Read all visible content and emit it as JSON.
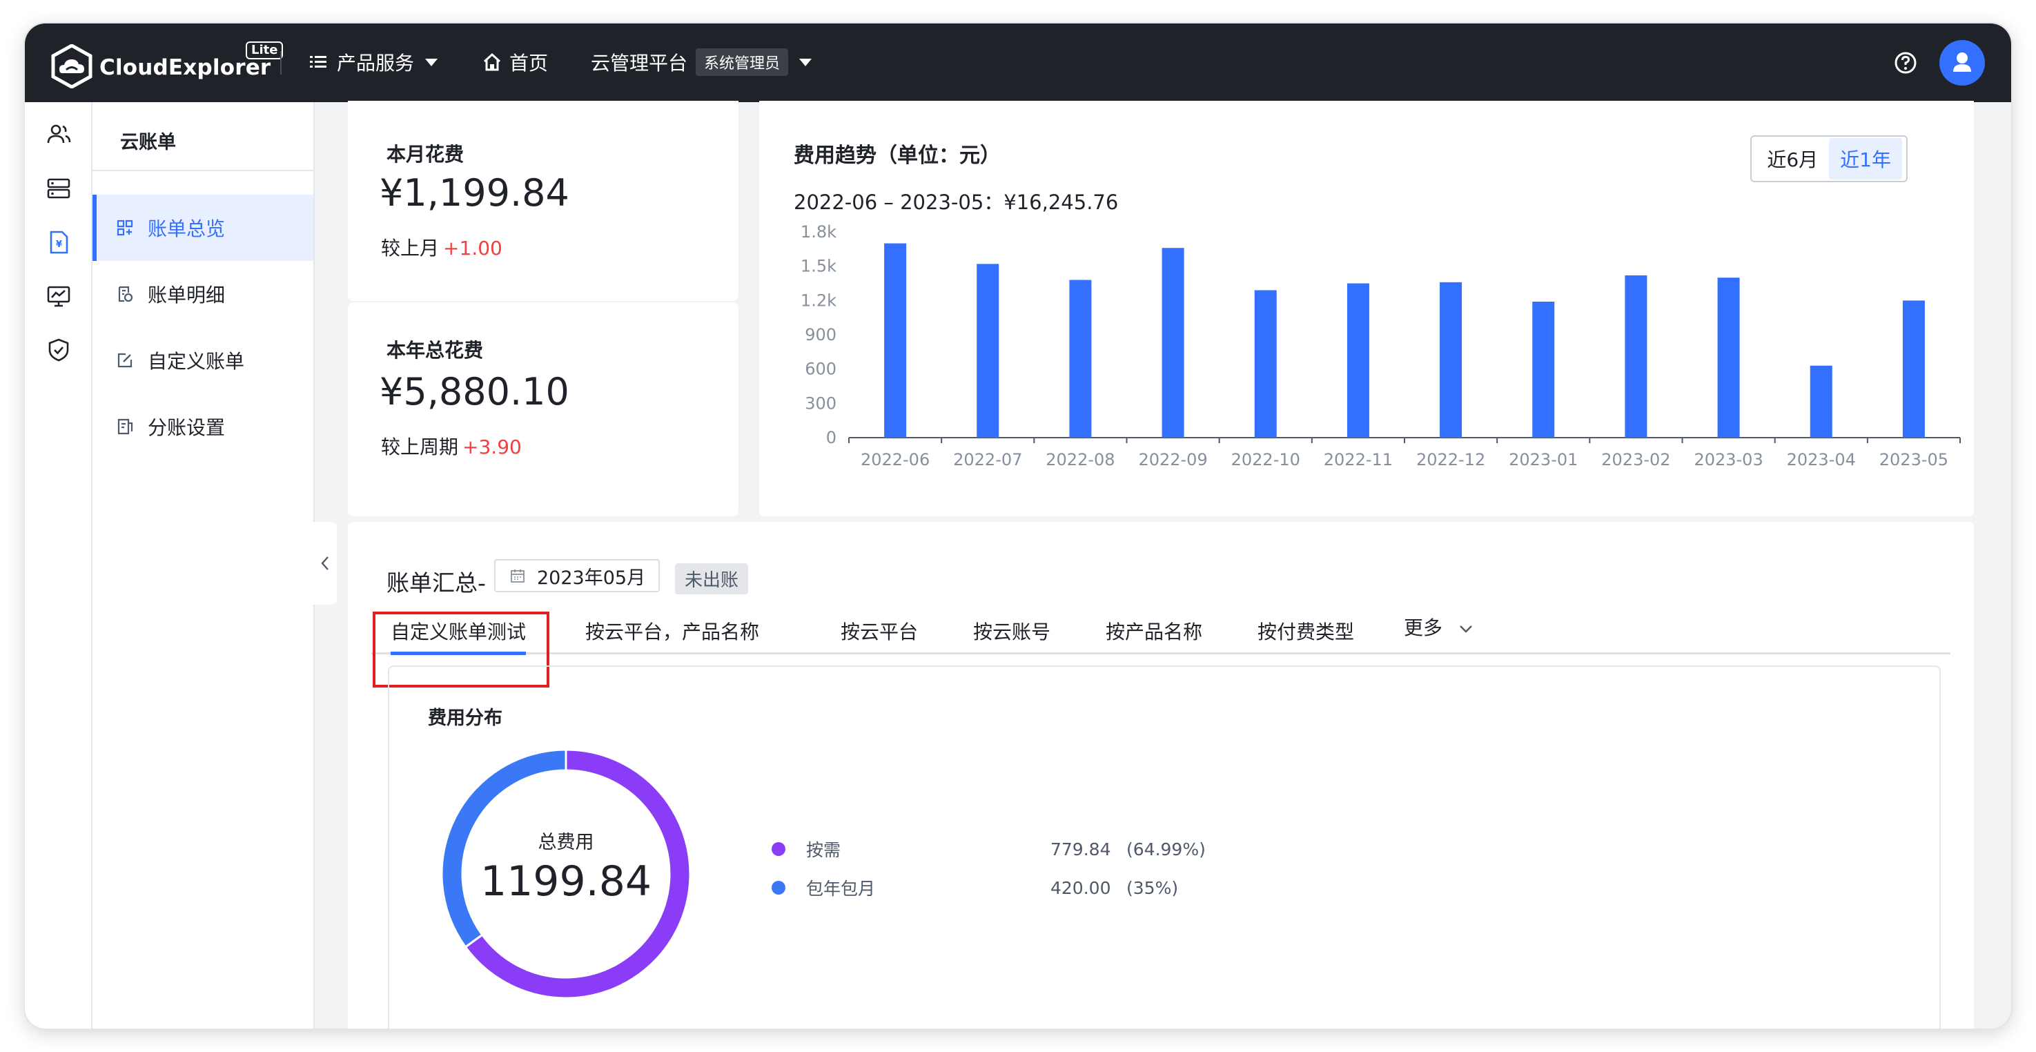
{
  "app": {
    "logo_text": "CloudExplorer",
    "logo_badge": "Lite"
  },
  "topnav": {
    "products": "产品服务",
    "home": "首页",
    "platform": "云管理平台",
    "role": "系统管理员"
  },
  "rail_icons": [
    "users-icon",
    "server-icon",
    "bill-icon",
    "monitor-icon",
    "shield-icon"
  ],
  "subnav": {
    "title": "云账单",
    "items": [
      {
        "label": "账单总览",
        "icon": "dashboard-icon",
        "active": true
      },
      {
        "label": "账单明细",
        "icon": "detail-icon",
        "active": false
      },
      {
        "label": "自定义账单",
        "icon": "edit-icon",
        "active": false
      },
      {
        "label": "分账设置",
        "icon": "settings-doc-icon",
        "active": false
      }
    ]
  },
  "kpi": {
    "month": {
      "label": "本月花费",
      "value": "¥1,199.84",
      "compare_label": "较上月",
      "delta": "+1.00"
    },
    "year": {
      "label": "本年总花费",
      "value": "¥5,880.10",
      "compare_label": "较上周期",
      "delta": "+3.90"
    }
  },
  "trend": {
    "title": "费用趋势（单位：元）",
    "range_text": "2022-06 – 2023-05：",
    "range_total": "¥16,245.76",
    "options": [
      "近6月",
      "近1年"
    ],
    "selected": "近1年"
  },
  "chart_data": {
    "type": "bar",
    "categories": [
      "2022-06",
      "2022-07",
      "2022-08",
      "2022-09",
      "2022-10",
      "2022-11",
      "2022-12",
      "2023-01",
      "2023-02",
      "2023-03",
      "2023-04",
      "2023-05"
    ],
    "values": [
      1700,
      1520,
      1380,
      1660,
      1290,
      1350,
      1360,
      1190,
      1420,
      1400,
      630,
      1199.84
    ],
    "yticks": [
      "0",
      "300",
      "600",
      "900",
      "1.2k",
      "1.5k",
      "1.8k"
    ],
    "ylim": [
      0,
      1800
    ],
    "color": "#3370ff",
    "grid": false
  },
  "summary": {
    "title": "账单汇总-",
    "month": "2023年05月",
    "status": "未出账",
    "tabs": [
      "自定义账单测试",
      "按云平台，产品名称",
      "按云平台",
      "按云账号",
      "按产品名称",
      "按付费类型",
      "更多"
    ],
    "active_tab": "自定义账单测试"
  },
  "distribution": {
    "title": "费用分布",
    "total_label": "总费用",
    "total_value": "1199.84",
    "items": [
      {
        "name": "按需",
        "amount": "779.84",
        "pct": "(64.99%)",
        "share": 0.6499,
        "color": "#8b3cf7"
      },
      {
        "name": "包年包月",
        "amount": "420.00",
        "pct": "(35%)",
        "share": 0.3501,
        "color": "#3b78f6"
      }
    ]
  }
}
